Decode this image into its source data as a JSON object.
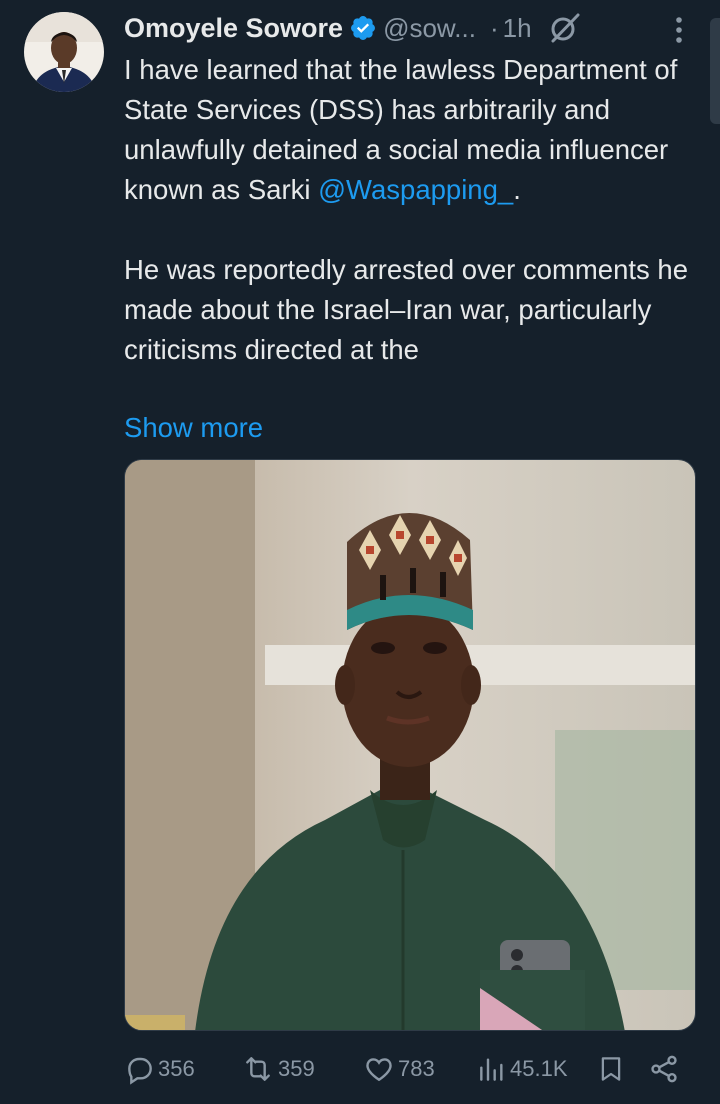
{
  "author": {
    "name": "Omoyele Sowore",
    "handle": "@sow...",
    "time": "1h",
    "separator": "·",
    "verified": true
  },
  "tweet": {
    "paragraph1_text": "I have learned that the lawless Department of State Services (DSS) has arbitrarily and unlawfully detained a social media influencer known as Sarki ",
    "mention": "@Waspapping_",
    "paragraph1_end": ".",
    "paragraph2": "He was reportedly arrested over comments he made about the Israel–Iran war, particularly criticisms directed at the",
    "show_more": "Show more"
  },
  "actions": {
    "replies": "356",
    "reposts": "359",
    "likes": "783",
    "views": "45.1K"
  },
  "icons": [
    "verified-badge-icon",
    "grok-icon",
    "more-icon",
    "reply-icon",
    "repost-icon",
    "like-icon",
    "views-icon",
    "bookmark-icon",
    "share-icon"
  ],
  "colors": {
    "background": "#15202b",
    "text": "#e7e9ea",
    "secondary": "#8b98a5",
    "accent": "#1d9bf0"
  }
}
